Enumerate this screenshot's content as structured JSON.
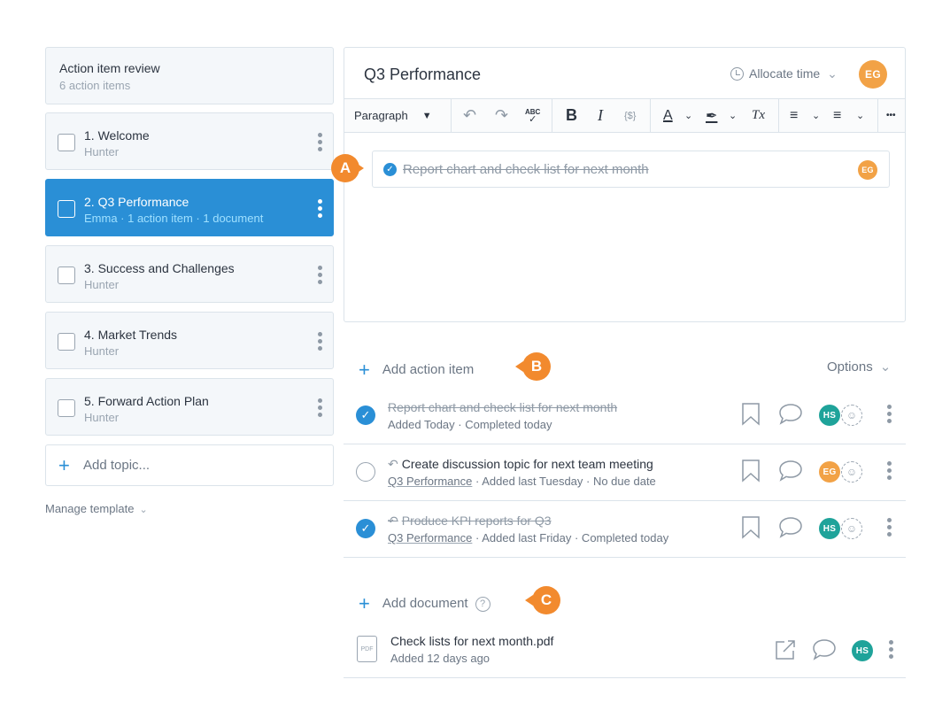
{
  "summary": {
    "title": "Action item review",
    "subtitle": "6 action items"
  },
  "topics": [
    {
      "title": "1. Welcome",
      "subtitle": "Hunter"
    },
    {
      "title": "2. Q3 Performance",
      "subtitle": "Emma · 1 action item · 1 document",
      "active": true
    },
    {
      "title": "3. Success and Challenges",
      "subtitle": "Hunter"
    },
    {
      "title": "4. Market Trends",
      "subtitle": "Hunter"
    },
    {
      "title": "5. Forward Action Plan",
      "subtitle": "Hunter"
    }
  ],
  "add_topic": {
    "label": "Add topic..."
  },
  "manage_template": {
    "label": "Manage template"
  },
  "editor": {
    "title": "Q3 Performance",
    "allocate_time": "Allocate time",
    "avatar_initials": "EG",
    "toolbar": {
      "paragraph": "Paragraph",
      "spellcheck": "ABC",
      "bold": "B",
      "italic": "I",
      "code": "{$}",
      "font_color": "A",
      "clear_format": "Tx",
      "more": "•••"
    },
    "inline_item": {
      "text": "Report chart and check list for next month",
      "avatar": "EG"
    }
  },
  "markers": {
    "a": "A",
    "b": "B",
    "c": "C"
  },
  "action_items": {
    "add_label": "Add action item",
    "options_label": "Options",
    "items": [
      {
        "title": "Report chart and check list for next month",
        "done": true,
        "meta_link": "",
        "meta": "Added Today · Completed today",
        "avatar": "HS"
      },
      {
        "title": "Create discussion topic for next team meeting",
        "done": false,
        "meta_link": "Q3 Performance",
        "meta": " · Added last Tuesday · No due date",
        "avatar": "EG"
      },
      {
        "title": "Produce KPI reports for Q3",
        "done": true,
        "meta_link": "Q3 Performance",
        "meta": " · Added last Friday · Completed today",
        "avatar": "HS"
      }
    ]
  },
  "documents": {
    "add_label": "Add document",
    "items": [
      {
        "name": "Check lists for next month.pdf",
        "meta": "Added 12 days ago",
        "avatar": "HS",
        "icon_label": "PDF"
      }
    ]
  },
  "colors": {
    "accent": "#2a8fd6",
    "marker": "#f28a2e",
    "avatar_orange": "#f2a246",
    "avatar_teal": "#1fa39a"
  }
}
